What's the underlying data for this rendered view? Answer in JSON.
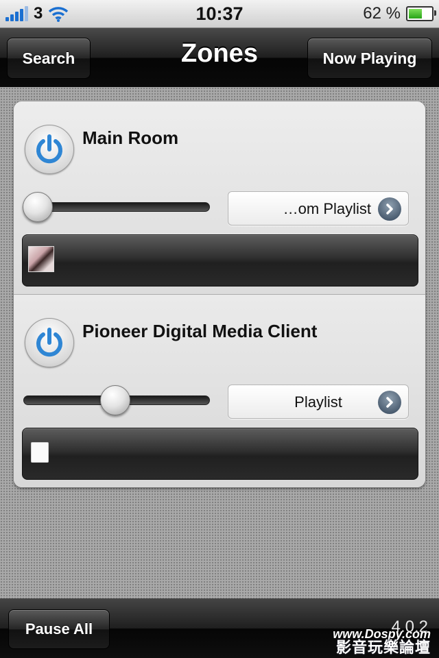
{
  "status_bar": {
    "carrier": "3",
    "time": "10:37",
    "battery_percent": "62 %",
    "battery_level": 0.62
  },
  "nav_bar": {
    "title": "Zones",
    "left_button": "Search",
    "right_button": "Now Playing"
  },
  "zones": [
    {
      "name": "Main Room",
      "volume": 0.0,
      "playlist_label": "…om Playlist",
      "has_album_art": true
    },
    {
      "name": "Pioneer Digital Media Client",
      "volume": 0.45,
      "playlist_label": "Playlist",
      "has_album_art": false
    }
  ],
  "toolbar": {
    "pause_all": "Pause All",
    "version": "4.0.2",
    "watermark_url": "www.Dospy.com",
    "watermark_text": "影音玩樂論壇"
  },
  "colors": {
    "power_blue": "#2f86d4",
    "signal_blue": "#1a6fd1",
    "battery_green": "#3cc02a"
  }
}
